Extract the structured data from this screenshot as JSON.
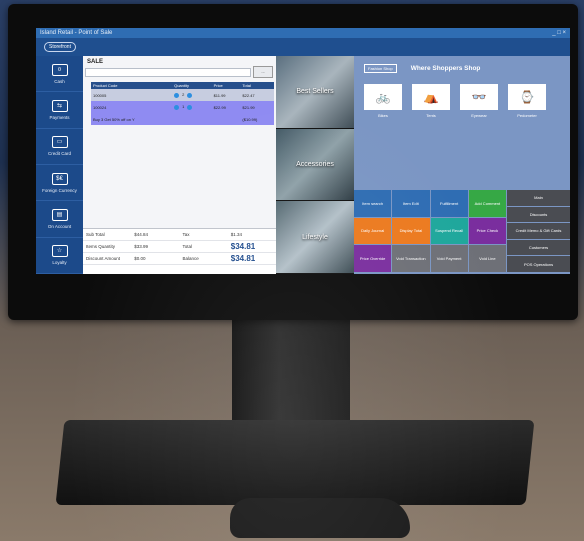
{
  "window": {
    "title": "Island Retail - Point of Sale",
    "controls": "_ □ ×"
  },
  "logo": "Storefront",
  "nav": [
    {
      "label": "Cash",
      "icon": "cash-icon",
      "glyph": "¤"
    },
    {
      "label": "Payments",
      "icon": "payments-icon",
      "glyph": "⇆"
    },
    {
      "label": "Credit Card",
      "icon": "credit-card-icon",
      "glyph": "▭"
    },
    {
      "label": "Foreign Currency",
      "icon": "foreign-currency-icon",
      "glyph": "$€"
    },
    {
      "label": "On Account",
      "icon": "on-account-icon",
      "glyph": "▤"
    },
    {
      "label": "Loyalty",
      "icon": "loyalty-icon",
      "glyph": "☆"
    }
  ],
  "sale": {
    "title": "SALE",
    "search_button": "...",
    "columns": [
      "Product Code",
      "Quantity",
      "Price",
      "Total"
    ],
    "rows": [
      {
        "code": "100005",
        "qty": "2",
        "price": "$11.99",
        "total": "$22.47"
      },
      {
        "code": "100024",
        "qty": "1",
        "price": "$22.99",
        "total": "$21.99"
      },
      {
        "code": "Buy 3 Get 50% off on Y",
        "qty": "",
        "price": "",
        "total": "($10.99)"
      }
    ]
  },
  "totals": {
    "sub_total_label": "Sub Total",
    "sub_total": "$44.84",
    "tax_label": "Tax",
    "tax": "$1.34",
    "items_qty_label": "Items Quantity",
    "items_qty": "$33.99",
    "total_label": "Total",
    "total": "$34.81",
    "discount_label": "Discount Amount",
    "discount": "$0.00",
    "balance_label": "Balance",
    "balance": "$34.81"
  },
  "tiles": [
    "Best Sellers",
    "Accessories",
    "Lifestyle"
  ],
  "shop": {
    "logo": "Fashion Shop",
    "slogan": "Where Shoppers Shop",
    "products": [
      {
        "label": "Bikes",
        "glyph": "🚲"
      },
      {
        "label": "Tents",
        "glyph": "⛺"
      },
      {
        "label": "Eyewear",
        "glyph": "👓"
      },
      {
        "label": "Pedometer",
        "glyph": "⌚"
      }
    ]
  },
  "functions": [
    {
      "label": "Item search",
      "color": "blue"
    },
    {
      "label": "Item Edit",
      "color": "blue"
    },
    {
      "label": "Fulfillment",
      "color": "blue"
    },
    {
      "label": "Add Comment",
      "color": "green"
    },
    {
      "label": "Daily Journal",
      "color": "orange"
    },
    {
      "label": "Display Total",
      "color": "orange"
    },
    {
      "label": "Suspend Recall",
      "color": "teal"
    },
    {
      "label": "Price Check",
      "color": "purple"
    },
    {
      "label": "Price Override",
      "color": "purple"
    },
    {
      "label": "Void Transaction",
      "color": "gray"
    },
    {
      "label": "Void Payment",
      "color": "gray"
    },
    {
      "label": "Void Line",
      "color": "gray"
    }
  ],
  "side_buttons": [
    "Main",
    "Discounts",
    "Credit Memo & Gift Cards",
    "Customers",
    "POS Operations"
  ]
}
